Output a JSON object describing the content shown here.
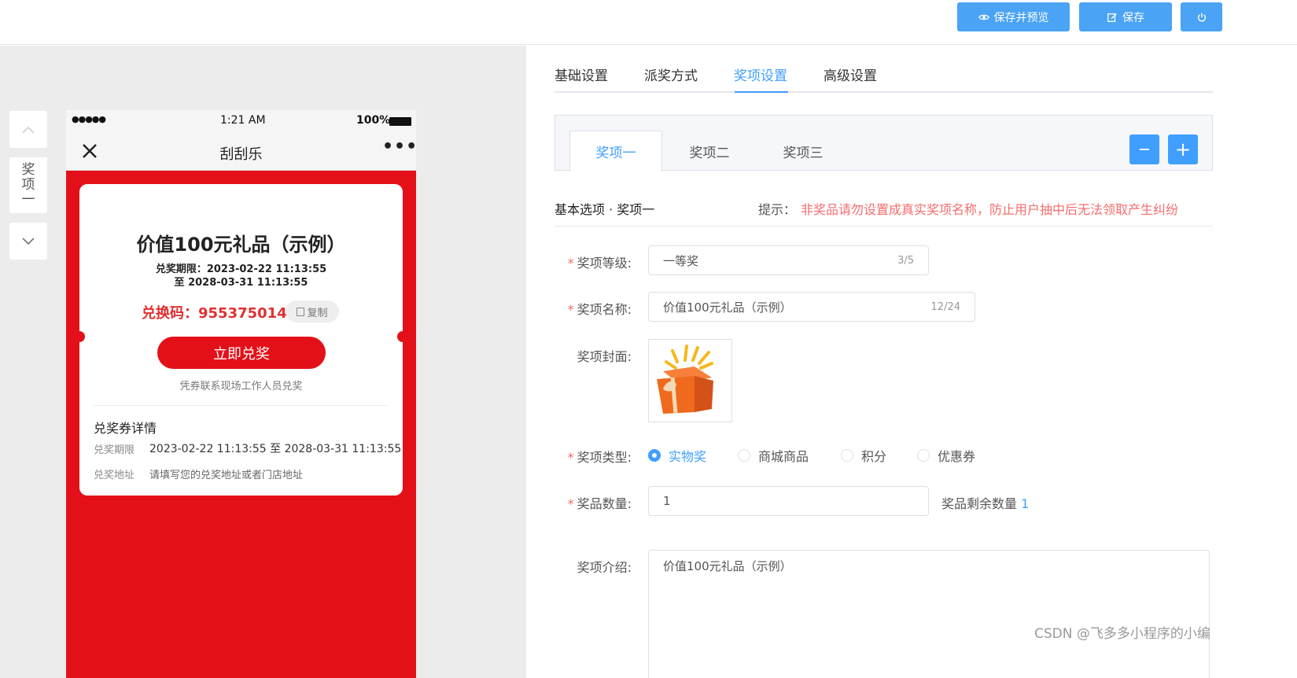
{
  "toolbar": {
    "save_preview_label": "保存并预览",
    "save_label": "保存"
  },
  "side_nav": {
    "label": [
      "奖",
      "项",
      "一"
    ]
  },
  "phone": {
    "status_signal": "●●●●●",
    "status_time": "1:21 AM",
    "status_battery": "100%",
    "nav_title": "刮刮乐",
    "card": {
      "prize_title": "价值100元礼品（示例）",
      "period_line1": "兑奖期限：2023-02-22 11:13:55",
      "period_line2": "至 2028-03-31 11:13:55",
      "code_label": "兑换码：",
      "code_value": "9553750148",
      "copy_label": "复制",
      "redeem_button": "立即兑奖",
      "redeem_hint": "凭券联系现场工作人员兑奖",
      "details_title": "兑奖券详情",
      "period_key": "兑奖期限",
      "period_value": "2023-02-22 11:13:55 至 2028-03-31 11:13:55",
      "address_key": "兑奖地址",
      "address_value": "请填写您的兑奖地址或者门店地址"
    }
  },
  "tabs": [
    {
      "label": "基础设置",
      "active": false
    },
    {
      "label": "派奖方式",
      "active": false
    },
    {
      "label": "奖项设置",
      "active": true
    },
    {
      "label": "高级设置",
      "active": false
    }
  ],
  "prize_tabs": [
    {
      "label": "奖项一",
      "active": true
    },
    {
      "label": "奖项二",
      "active": false
    },
    {
      "label": "奖项三",
      "active": false
    }
  ],
  "section": {
    "title": "基本选项 · 奖项一",
    "tip_label": "提示：",
    "tip_text": "非奖品请勿设置成真实奖项名称，防止用户抽中后无法领取产生纠纷"
  },
  "form": {
    "level_label": "奖项等级:",
    "level_value": "一等奖",
    "level_count": "3/5",
    "name_label": "奖项名称:",
    "name_value": "价值100元礼品（示例）",
    "name_count": "12/24",
    "cover_label": "奖项封面:",
    "type_label": "奖项类型:",
    "type_options": [
      {
        "label": "实物奖",
        "selected": true
      },
      {
        "label": "商城商品",
        "selected": false
      },
      {
        "label": "积分",
        "selected": false
      },
      {
        "label": "优惠券",
        "selected": false
      }
    ],
    "quantity_label": "奖品数量:",
    "quantity_value": "1",
    "remaining_label": "奖品剩余数量",
    "remaining_value": "1",
    "intro_label": "奖项介绍:",
    "intro_value": "价值100元礼品（示例）"
  },
  "watermark": "CSDN @飞多多小程序的小编",
  "colors": {
    "primary": "#409eff",
    "button_blue": "#4aa3f5",
    "brand_red": "#e41019",
    "warning_red": "#f56c6c"
  }
}
